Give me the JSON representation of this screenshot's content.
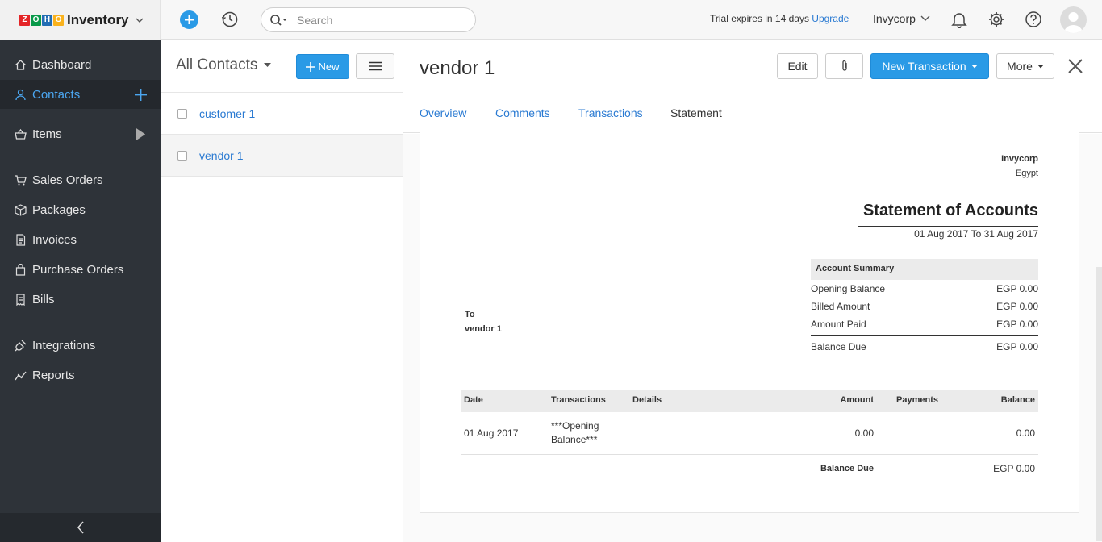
{
  "app": {
    "brand_logo": [
      "Z",
      "O",
      "H",
      "O"
    ],
    "brand_colors": [
      "#e42527",
      "#089949",
      "#226db4",
      "#f9b21d"
    ],
    "product": "Inventory"
  },
  "topbar": {
    "search_placeholder": "Search",
    "trial_text": "Trial expires in 14 days",
    "upgrade_label": "Upgrade",
    "org_name": "Invycorp"
  },
  "sidebar": {
    "items": [
      {
        "label": "Dashboard",
        "icon": "home-icon"
      },
      {
        "label": "Contacts",
        "icon": "user-icon",
        "active": true
      },
      {
        "label": "Items",
        "icon": "basket-icon"
      },
      {
        "label": "Sales Orders",
        "icon": "cart-icon"
      },
      {
        "label": "Packages",
        "icon": "package-icon"
      },
      {
        "label": "Invoices",
        "icon": "invoice-icon"
      },
      {
        "label": "Purchase Orders",
        "icon": "bag-icon"
      },
      {
        "label": "Bills",
        "icon": "bill-icon"
      },
      {
        "label": "Integrations",
        "icon": "plug-icon"
      },
      {
        "label": "Reports",
        "icon": "chart-icon"
      }
    ]
  },
  "list": {
    "title": "All Contacts",
    "new_label": "New",
    "contacts": [
      {
        "name": "customer 1"
      },
      {
        "name": "vendor 1",
        "selected": true
      }
    ]
  },
  "detail": {
    "title": "vendor 1",
    "edit_label": "Edit",
    "new_transaction_label": "New Transaction",
    "more_label": "More",
    "tabs": [
      "Overview",
      "Comments",
      "Transactions",
      "Statement"
    ],
    "active_tab": "Statement"
  },
  "statement": {
    "org_name": "Invycorp",
    "org_country": "Egypt",
    "title": "Statement of Accounts",
    "period": "01 Aug 2017 To 31 Aug 2017",
    "to_label": "To",
    "to_name": "vendor 1",
    "summary_header": "Account Summary",
    "summary": [
      {
        "label": "Opening Balance",
        "value": "EGP 0.00"
      },
      {
        "label": "Billed Amount",
        "value": "EGP 0.00"
      },
      {
        "label": "Amount Paid",
        "value": "EGP 0.00"
      }
    ],
    "summary_total": {
      "label": "Balance Due",
      "value": "EGP 0.00"
    },
    "table": {
      "headers": [
        "Date",
        "Transactions",
        "Details",
        "Amount",
        "Payments",
        "Balance"
      ],
      "rows": [
        {
          "date": "01 Aug 2017",
          "transaction": "***Opening Balance***",
          "details": "",
          "amount": "0.00",
          "payments": "",
          "balance": "0.00"
        }
      ],
      "footer_label": "Balance Due",
      "footer_value": "EGP 0.00"
    }
  },
  "colors": {
    "accent": "#2a9ae6",
    "link": "#2a7ad2",
    "sidebar_bg": "#2e3339"
  }
}
